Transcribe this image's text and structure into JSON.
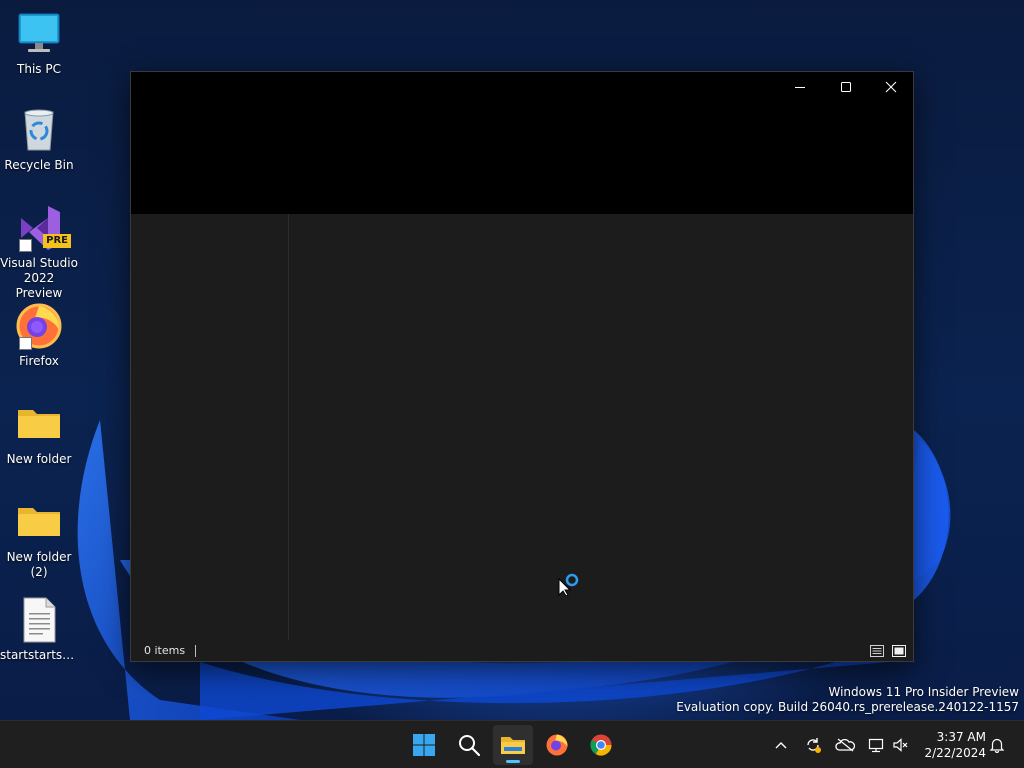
{
  "desktop": {
    "icons": [
      {
        "label": "This PC",
        "icon": "computer-icon"
      },
      {
        "label": "Recycle Bin",
        "icon": "recycle-bin-icon"
      },
      {
        "label": "Visual Studio 2022 Preview",
        "icon": "visual-studio-icon",
        "badge": "PRE"
      },
      {
        "label": "Firefox",
        "icon": "firefox-icon"
      },
      {
        "label": "New folder",
        "icon": "folder-icon"
      },
      {
        "label": "New folder (2)",
        "icon": "folder-icon"
      },
      {
        "label": "startstartsta...",
        "icon": "text-file-icon"
      }
    ]
  },
  "window": {
    "caption_buttons": [
      "minimize-icon",
      "maximize-icon",
      "close-icon"
    ],
    "status": {
      "item_count": "0 items"
    },
    "view_buttons": [
      "details-view-icon",
      "large-icons-view-icon"
    ]
  },
  "watermark": {
    "line1": "Windows 11 Pro Insider Preview",
    "line2": "Evaluation copy. Build 26040.rs_prerelease.240122-1157"
  },
  "taskbar": {
    "apps": [
      "start-icon",
      "search-icon",
      "file-explorer-icon",
      "firefox-icon",
      "chrome-icon"
    ],
    "active_app": "file-explorer-icon",
    "tray": [
      "chevron-up-icon",
      "sync-icon",
      "onedrive-icon",
      "network-icon",
      "speaker-muted-icon",
      "notification-icon"
    ],
    "clock": {
      "time": "3:37 AM",
      "date": "2/22/2024"
    }
  },
  "colors": {
    "accent": "#4cc2ff",
    "window_bg": "#1c1c1c",
    "titlebar_bg": "#000000",
    "taskbar_bg": "#1f1f1f",
    "folder_yellow": "#f8cd45"
  }
}
